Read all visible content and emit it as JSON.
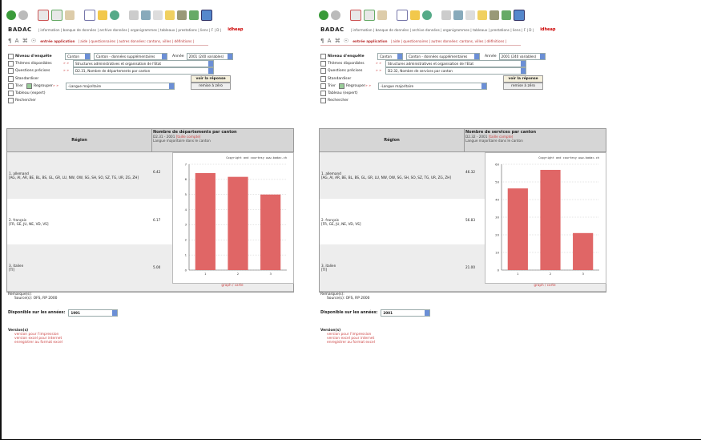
{
  "panes": [
    {
      "logo": "BADAC",
      "nav_links": "| information | banque de données | archive données | organigrammes | tableaux | prestations | liens | F | D |",
      "brand": "idheap",
      "subnav_icons": "¶ A ⌘ ☉",
      "subnav_active": "entrée application",
      "subnav_rest": "| aide | questionnaires | autres données: cantons, villes | définitions |",
      "form": {
        "niveau_label": "Niveau d'enquête",
        "niveau_value": "Canton",
        "dataset_value": "Canton - données supplémentaires",
        "annee_label": "Année",
        "annee_value": "2001 (240 variables)",
        "themes_label": "Thèmes disponibles",
        "themes_value": "Structures administratives et organisation de l'Etat",
        "questions_label": "Questions précises",
        "questions_value": "D2.31, Nombre de départements par canton",
        "standardiser_label": "Standardiser",
        "trier_label": "Trier",
        "regrouper_label": "Regrouper",
        "regrouper_value": "-Langue majoritaire",
        "tableau_expert_label": "Tableau (expert)",
        "rechercher_label": "Rechercher",
        "voir_btn": "voir la réponse",
        "reset_btn": "remise à zéro",
        "arrows": "» »"
      },
      "table": {
        "region_header": "Région",
        "indicator_title": "Nombre de départements par canton",
        "indicator_code": "D2.31 - 2001",
        "indicator_link": "[taille compte]",
        "indicator_group": "Langue majoritaire dans le canton",
        "rows": [
          {
            "label": "1. allemand",
            "cantons": "[AG, AI, AR, BE, BL, BS, GL, GR, LU, NW, OW, SG, SH, SO, SZ, TG, UR, ZG, ZH]",
            "value": "6.42"
          },
          {
            "label": "2. français",
            "cantons": "[FR, GE, JU, NE, VD, VS]",
            "value": "6.17"
          },
          {
            "label": "3. italien",
            "cantons": "[TI]",
            "value": "5.00"
          }
        ],
        "chart_link": "graph / carte"
      },
      "remarks_label": "Remarque(s):",
      "source": "Source(s): OFS, RP 2000",
      "dispo_label": "Disponible sur les années:",
      "dispo_value": "1991",
      "versions_label": "Version(s)",
      "versions_links": [
        "version pour l'impression",
        "version excel pour internet",
        "enregistrer au format excel"
      ]
    },
    {
      "logo": "BADAC",
      "nav_links": "| information | banque de données | archive données | organigrammes | tableaux | prestations | liens | F | D |",
      "brand": "idheap",
      "subnav_icons": "¶ A ⌘ ☉",
      "subnav_active": "entrée application",
      "subnav_rest": "| aide | questionnaires | autres données: cantons, villes | définitions |",
      "form": {
        "niveau_label": "Niveau d'enquête",
        "niveau_value": "Canton",
        "dataset_value": "Canton - données supplémentaires",
        "annee_label": "Année",
        "annee_value": "2001 (240 variables)",
        "themes_label": "Thèmes disponibles",
        "themes_value": "Structures administratives et organisation de l'Etat",
        "questions_label": "Questions précises",
        "questions_value": "D2.32, Nombre de services par canton",
        "standardiser_label": "Standardiser",
        "trier_label": "Trier",
        "regrouper_label": "Regrouper",
        "regrouper_value": "-Langue majoritaire",
        "tableau_expert_label": "Tableau (expert)",
        "rechercher_label": "Rechercher",
        "voir_btn": "voir la réponse",
        "reset_btn": "remise à zéro",
        "arrows": "» »"
      },
      "table": {
        "region_header": "Région",
        "indicator_title": "Nombre de services par canton",
        "indicator_code": "D2.32 - 2001",
        "indicator_link": "[taille compte]",
        "indicator_group": "Langue majoritaire dans le canton",
        "rows": [
          {
            "label": "1. allemand",
            "cantons": "[AG, AI, AR, BE, BL, BS, GL, GR, LU, NW, OW, SG, SH, SO, SZ, TG, UR, ZG, ZH]",
            "value": "46.32"
          },
          {
            "label": "2. français",
            "cantons": "[FR, GE, JU, NE, VD, VS]",
            "value": "56.83"
          },
          {
            "label": "3. italien",
            "cantons": "[TI]",
            "value": "21.00"
          }
        ],
        "chart_link": "graph / carte"
      },
      "remarks_label": "Remarque(s):",
      "source": "Source(s): OFS, RP 2000",
      "dispo_label": "Disponible sur les années:",
      "dispo_value": "2001",
      "versions_label": "Version(s)",
      "versions_links": [
        "version pour l'impression",
        "version excel pour internet",
        "enregistrer au format excel"
      ]
    }
  ],
  "chart_data": [
    {
      "type": "bar",
      "title": "",
      "corner_note": "Copyright and courtesy www.badac.ch",
      "categories": [
        "1",
        "2",
        "3"
      ],
      "values": [
        6.42,
        6.17,
        5.0
      ],
      "ylim": [
        0,
        7
      ],
      "yticks": [
        0,
        1,
        2,
        3,
        4,
        5,
        6,
        7
      ],
      "grid": true,
      "bar_color": "#e06666"
    },
    {
      "type": "bar",
      "title": "",
      "corner_note": "Copyright and courtesy www.badac.ch",
      "categories": [
        "1",
        "2",
        "3"
      ],
      "values": [
        46.32,
        56.83,
        21.0
      ],
      "ylim": [
        0,
        60
      ],
      "yticks": [
        0,
        10,
        20,
        30,
        40,
        50,
        60
      ],
      "grid": true,
      "bar_color": "#e06666"
    }
  ],
  "toolbar_icons": [
    "back-icon",
    "forward-icon",
    "stop-icon",
    "refresh-icon",
    "home-icon",
    "search-icon",
    "favorites-icon",
    "media-icon",
    "history-icon",
    "mail-icon",
    "print-icon",
    "edit-icon",
    "discuss-icon",
    "messenger-icon"
  ],
  "colors": {
    "accent": "#c44",
    "bar": "#e06666",
    "header_gray": "#d6d6d6"
  }
}
